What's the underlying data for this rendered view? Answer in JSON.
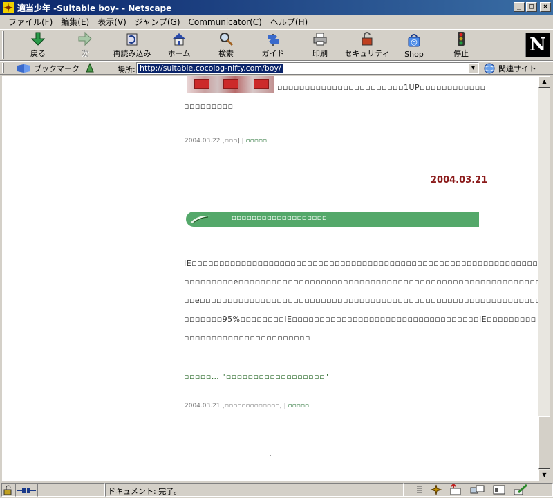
{
  "window": {
    "title": "適当少年 -Suitable boy- - Netscape"
  },
  "menu": [
    "ファイル(F)",
    "編集(E)",
    "表示(V)",
    "ジャンプ(G)",
    "Communicator(C)",
    "ヘルプ(H)"
  ],
  "toolbar": {
    "back": "戻る",
    "forward": "次",
    "reload": "再読み込み",
    "home": "ホーム",
    "search": "検索",
    "guide": "ガイド",
    "print": "印刷",
    "security": "セキュリティ",
    "shop": "Shop",
    "stop": "停止"
  },
  "location": {
    "bookmarks": "ブックマーク",
    "label": "場所:",
    "url": "http://suitable.cocolog-nifty.com/boy/",
    "related": "関連サイト"
  },
  "content": {
    "post1": {
      "line1": "▫▫▫▫▫▫▫▫▫▫▫▫▫▫▫▫▫▫▫▫▫▫▫1UP▫▫▫▫▫▫▫▫▫▫▫▫",
      "line2": "▫▫▫▫▫▫▫▫▫",
      "meta_date": "2004.03.22",
      "meta_cat": "[▫▫▫]",
      "meta_sep": "|",
      "meta_link": "▫▫▫▫▫"
    },
    "date_header": "2004.03.21",
    "banner_title": "▫▫▫▫▫▫▫▫▫▫▫▫▫▫▫▫▫▫▫",
    "post2": {
      "line1": "IE▫▫▫▫▫▫▫▫▫▫▫▫▫▫▫▫▫▫▫▫▫▫▫▫▫▫▫▫▫▫▫▫▫▫▫▫▫▫▫▫▫▫▫▫▫▫▫▫▫▫▫▫▫▫▫▫▫▫▫▫▫▫▫▫▫▫▫▫▫▫",
      "line2": "▫▫▫▫▫▫▫▫▫e▫▫▫▫▫▫▫▫▫▫▫▫▫▫▫▫▫▫▫▫▫▫▫▫▫▫▫▫▫▫▫▫▫▫▫▫▫▫▫▫▫▫▫▫▫▫▫▫▫▫▫▫▫▫▫▫▫▫▫▫▫▫▫",
      "line3": "▫▫e▫▫▫▫▫▫▫▫▫▫▫▫▫▫▫▫▫▫▫▫▫▫▫▫▫▫▫▫▫▫▫▫▫▫▫▫▫▫▫▫▫▫▫▫▫▫▫▫▫▫▫▫▫▫▫▫▫▫▫▫▫▫▫▫▫▫▫▫▫▫",
      "line4": "▫▫▫▫▫▫▫95%▫▫▫▫▫▫▫▫IE▫▫▫▫▫▫▫▫▫▫▫▫▫▫▫▫▫▫▫▫▫▫▫▫▫▫▫▫▫▫▫▫▫▫IE▫▫▫▫▫▫▫▫▫",
      "line5": "▫▫▫▫▫▫▫▫▫▫▫▫▫▫▫▫▫▫▫▫▫▫▫",
      "trackback": "▫▫▫▫▫… \"▫▫▫▫▫▫▫▫▫▫▫▫▫▫▫▫▫▫\"",
      "meta_date": "2004.03.21",
      "meta_cat": "[▫▫▫▫▫▫▫▫▫▫▫▫▫]",
      "meta_sep": "|",
      "meta_link": "▫▫▫▫▫"
    }
  },
  "status": {
    "text": "ドキュメント: 完了。"
  }
}
